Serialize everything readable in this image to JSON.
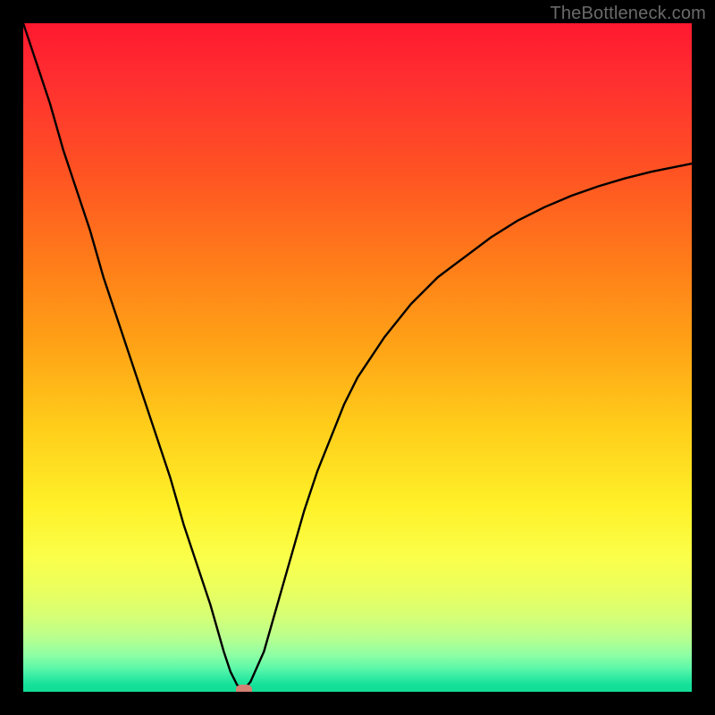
{
  "watermark": {
    "text": "TheBottleneck.com"
  },
  "chart_data": {
    "type": "line",
    "title": "",
    "xlabel": "",
    "ylabel": "",
    "xlim": [
      0,
      100
    ],
    "ylim": [
      0,
      100
    ],
    "grid": false,
    "legend": false,
    "background": "rainbow-vertical",
    "series": [
      {
        "name": "bottleneck-curve",
        "x": [
          0,
          2,
          4,
          6,
          8,
          10,
          12,
          14,
          16,
          18,
          20,
          22,
          24,
          26,
          28,
          30,
          31,
          32,
          33,
          34,
          36,
          38,
          40,
          42,
          44,
          46,
          48,
          50,
          54,
          58,
          62,
          66,
          70,
          74,
          78,
          82,
          86,
          90,
          94,
          98,
          100
        ],
        "y": [
          100,
          94,
          88,
          81,
          75,
          69,
          62,
          56,
          50,
          44,
          38,
          32,
          25,
          19,
          13,
          6,
          3,
          1,
          0.3,
          1.5,
          6,
          13,
          20,
          27,
          33,
          38,
          43,
          47,
          53,
          58,
          62,
          65,
          68,
          70.5,
          72.5,
          74.2,
          75.6,
          76.8,
          77.8,
          78.6,
          79
        ]
      }
    ],
    "marker": {
      "x": 33,
      "y": 0.3,
      "color": "#d48174"
    }
  }
}
